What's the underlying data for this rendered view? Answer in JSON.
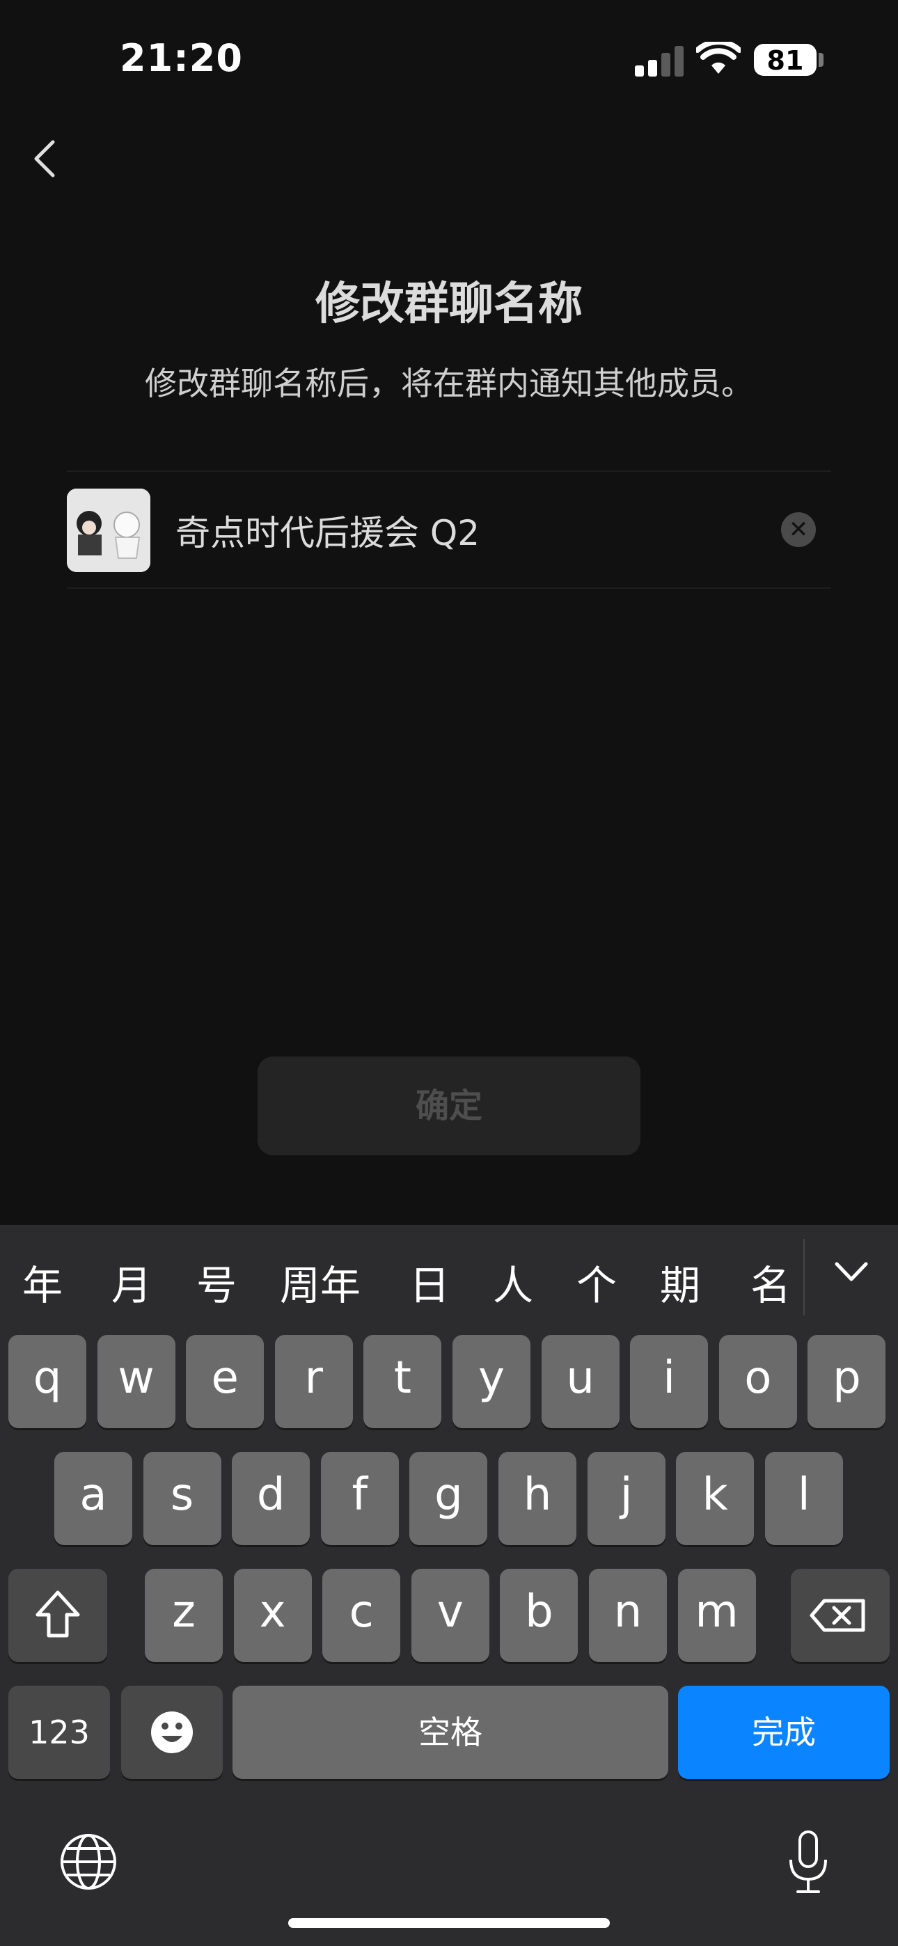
{
  "status_bar": {
    "time": "21:20",
    "battery": "81"
  },
  "page": {
    "title": "修改群聊名称",
    "subtitle": "修改群聊名称后，将在群内通知其他成员。",
    "group_name_value": "奇点时代后援会 Q2",
    "confirm_label": "确定"
  },
  "keyboard": {
    "candidates": [
      "年",
      "月",
      "号",
      "周年",
      "日",
      "人",
      "个",
      "期",
      "名"
    ],
    "row1": [
      "q",
      "w",
      "e",
      "r",
      "t",
      "y",
      "u",
      "i",
      "o",
      "p"
    ],
    "row2": [
      "a",
      "s",
      "d",
      "f",
      "g",
      "h",
      "j",
      "k",
      "l"
    ],
    "row3": [
      "z",
      "x",
      "c",
      "v",
      "b",
      "n",
      "m"
    ],
    "numbers_label": "123",
    "space_label": "空格",
    "done_label": "完成"
  },
  "colors": {
    "background": "#111111",
    "keyboard": "#2c2c2e",
    "key": "#6b6b6b",
    "accent": "#0a84ff"
  },
  "icons": [
    "cellular-signal-icon",
    "wifi-icon",
    "back-chevron-icon",
    "clear-icon",
    "chevron-down-icon",
    "shift-icon",
    "backspace-icon",
    "emoji-icon",
    "globe-icon",
    "microphone-icon"
  ]
}
